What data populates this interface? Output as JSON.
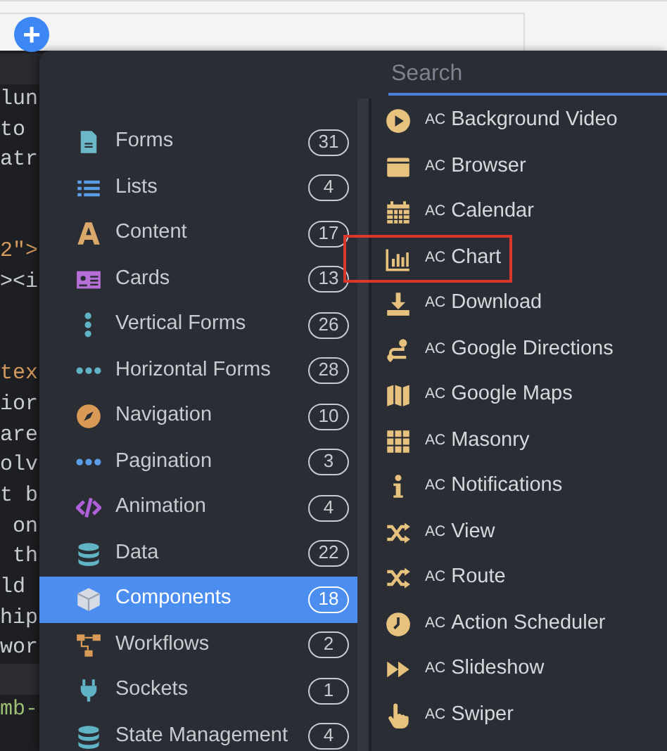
{
  "add_button": {
    "label": "+"
  },
  "editor": {
    "lines": [
      {
        "kind": "plain",
        "text": "lun"
      },
      {
        "kind": "plain",
        "text": "to"
      },
      {
        "kind": "plain",
        "text": "atr"
      },
      {
        "kind": "blank"
      },
      {
        "kind": "blank"
      },
      {
        "kind": "attr",
        "text": "2\">"
      },
      {
        "kind": "tag",
        "text": "><i"
      },
      {
        "kind": "blank"
      },
      {
        "kind": "blank"
      },
      {
        "kind": "attr",
        "text": "tex"
      },
      {
        "kind": "plain",
        "text": "ior"
      },
      {
        "kind": "plain",
        "text": "are"
      },
      {
        "kind": "plain",
        "text": "olv"
      },
      {
        "kind": "plain",
        "text": "t b"
      },
      {
        "kind": "plain",
        "text": " on"
      },
      {
        "kind": "plain",
        "text": " th"
      },
      {
        "kind": "plain",
        "text": "ld"
      },
      {
        "kind": "plain",
        "text": "hip"
      },
      {
        "kind": "plain",
        "text": "wor"
      },
      {
        "kind": "band"
      },
      {
        "kind": "class",
        "text": "mb-"
      }
    ]
  },
  "search": {
    "placeholder": "Search"
  },
  "categories": [
    {
      "label": "Forms",
      "count": "31",
      "selected": false
    },
    {
      "label": "Lists",
      "count": "4",
      "selected": false
    },
    {
      "label": "Content",
      "count": "17",
      "selected": false
    },
    {
      "label": "Cards",
      "count": "13",
      "selected": false
    },
    {
      "label": "Vertical Forms",
      "count": "26",
      "selected": false
    },
    {
      "label": "Horizontal Forms",
      "count": "28",
      "selected": false
    },
    {
      "label": "Navigation",
      "count": "10",
      "selected": false
    },
    {
      "label": "Pagination",
      "count": "3",
      "selected": false
    },
    {
      "label": "Animation",
      "count": "4",
      "selected": false
    },
    {
      "label": "Data",
      "count": "22",
      "selected": false
    },
    {
      "label": "Components",
      "count": "18",
      "selected": true
    },
    {
      "label": "Workflows",
      "count": "2",
      "selected": false
    },
    {
      "label": "Sockets",
      "count": "1",
      "selected": false
    },
    {
      "label": "State Management",
      "count": "4",
      "selected": false
    }
  ],
  "components": [
    {
      "prefix": "AC",
      "label": "Background Video",
      "highlighted": false
    },
    {
      "prefix": "AC",
      "label": "Browser",
      "highlighted": false
    },
    {
      "prefix": "AC",
      "label": "Calendar",
      "highlighted": false
    },
    {
      "prefix": "AC",
      "label": "Chart",
      "highlighted": true
    },
    {
      "prefix": "AC",
      "label": "Download",
      "highlighted": false
    },
    {
      "prefix": "AC",
      "label": "Google Directions",
      "highlighted": false
    },
    {
      "prefix": "AC",
      "label": "Google Maps",
      "highlighted": false
    },
    {
      "prefix": "AC",
      "label": "Masonry",
      "highlighted": false
    },
    {
      "prefix": "AC",
      "label": "Notifications",
      "highlighted": false
    },
    {
      "prefix": "AC",
      "label": "View",
      "highlighted": false
    },
    {
      "prefix": "AC",
      "label": "Route",
      "highlighted": false
    },
    {
      "prefix": "AC",
      "label": "Action Scheduler",
      "highlighted": false
    },
    {
      "prefix": "AC",
      "label": "Slideshow",
      "highlighted": false
    },
    {
      "prefix": "AC",
      "label": "Swiper",
      "highlighted": false
    }
  ]
}
